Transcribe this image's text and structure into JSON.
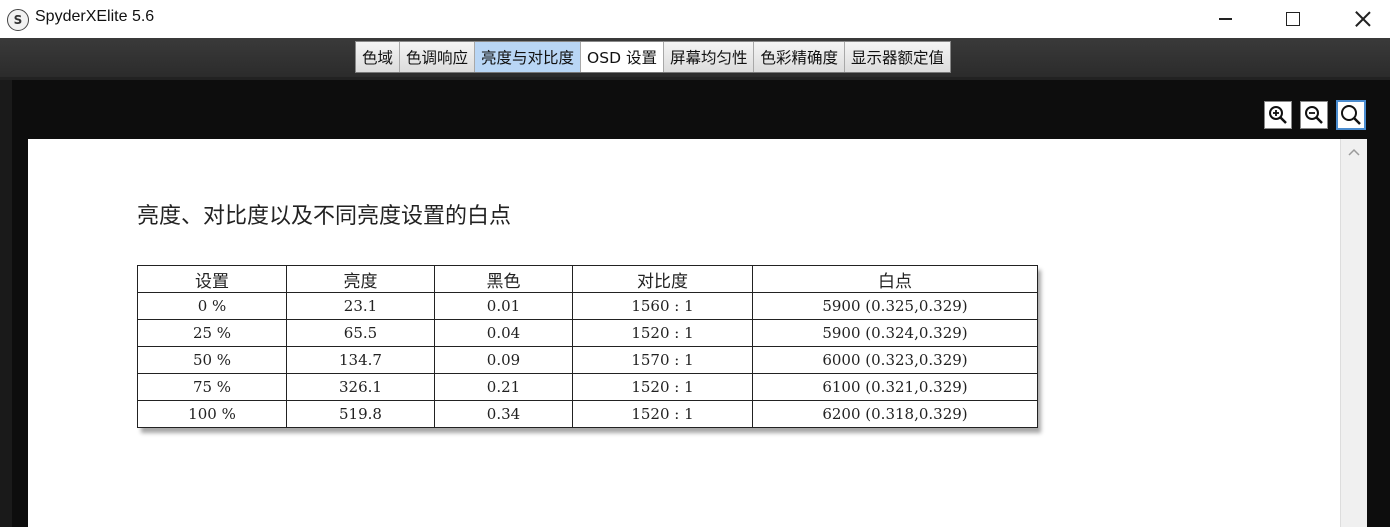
{
  "window": {
    "title": "SpyderXElite 5.6",
    "app_icon_letter": "S"
  },
  "tabs": [
    {
      "label": "色域",
      "state": "normal"
    },
    {
      "label": "色调响应",
      "state": "normal"
    },
    {
      "label": "亮度与对比度",
      "state": "active"
    },
    {
      "label": "OSD 设置",
      "state": "selected-white"
    },
    {
      "label": "屏幕均匀性",
      "state": "normal"
    },
    {
      "label": "色彩精确度",
      "state": "normal"
    },
    {
      "label": "显示器额定值",
      "state": "normal"
    }
  ],
  "toolbar": {
    "zoom_in_icon": "zoom-in-icon",
    "zoom_out_icon": "zoom-out-icon",
    "zoom_fit_icon": "zoom-fit-icon"
  },
  "report": {
    "title": "亮度、对比度以及不同亮度设置的白点",
    "table": {
      "headers": [
        "设置",
        "亮度",
        "黑色",
        "对比度",
        "白点"
      ],
      "rows": [
        [
          "0 %",
          "23.1",
          "0.01",
          "1560 : 1",
          "5900 (0.325,0.329)"
        ],
        [
          "25 %",
          "65.5",
          "0.04",
          "1520 : 1",
          "5900 (0.324,0.329)"
        ],
        [
          "50 %",
          "134.7",
          "0.09",
          "1570 : 1",
          "6000 (0.323,0.329)"
        ],
        [
          "75 %",
          "326.1",
          "0.21",
          "1520 : 1",
          "6100 (0.321,0.329)"
        ],
        [
          "100 %",
          "519.8",
          "0.34",
          "1520 : 1",
          "6200 (0.318,0.329)"
        ]
      ]
    }
  },
  "colors": {
    "active_tab": "#b9d6f5",
    "dark_background": "#1a1a1a",
    "zoom_fit_border": "#4a8ccf"
  }
}
